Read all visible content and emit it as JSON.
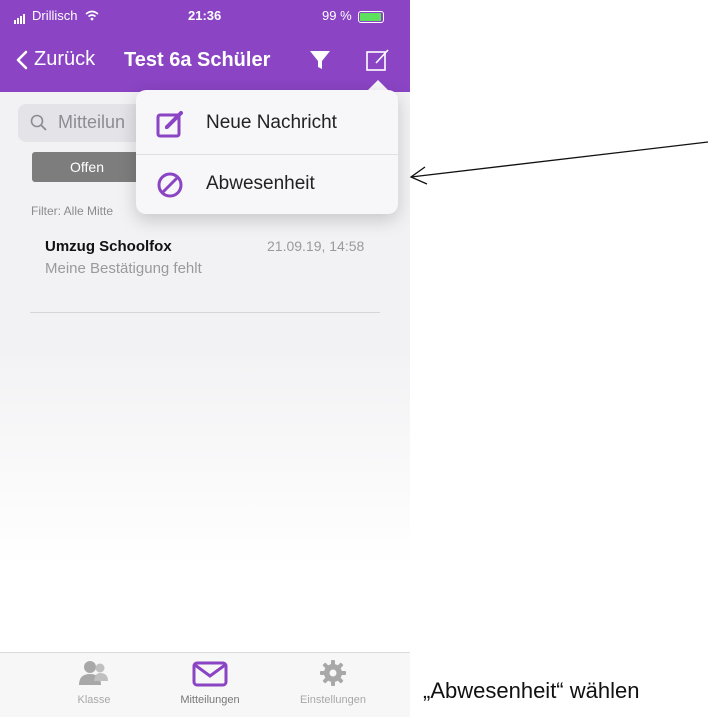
{
  "status_bar": {
    "carrier": "Drillisch",
    "time": "21:36",
    "battery": "99 %"
  },
  "nav": {
    "back_label": "Zurück",
    "title": "Test 6a Schüler",
    "filter_icon": "funnel-icon",
    "compose_icon": "compose-icon"
  },
  "search": {
    "placeholder": "Mitteilun"
  },
  "segment": {
    "selected": "Offen"
  },
  "filter_text": "Filter: Alle Mitte",
  "messages": [
    {
      "title": "Umzug Schoolfox",
      "subtitle": "Meine Bestätigung fehlt",
      "timestamp": "21.09.19, 14:58"
    }
  ],
  "dropdown": {
    "items": [
      {
        "label": "Neue Nachricht",
        "icon": "compose-icon"
      },
      {
        "label": "Abwesenheit",
        "icon": "no-entry-icon"
      }
    ]
  },
  "tabbar": {
    "tabs": [
      {
        "label": "Klasse",
        "icon": "people-icon",
        "active": false
      },
      {
        "label": "Mitteilungen",
        "icon": "envelope-icon",
        "active": true
      },
      {
        "label": "Einstellungen",
        "icon": "gear-icon",
        "active": false
      }
    ]
  },
  "annotation": {
    "caption": "„Abwesenheit“ wählen"
  },
  "colors": {
    "accent": "#8a44c4",
    "inactive_tab": "#a8a8a8"
  }
}
